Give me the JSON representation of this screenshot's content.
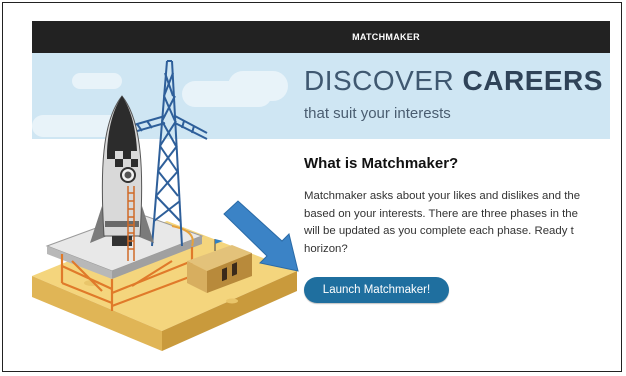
{
  "header": {
    "title": "MATCHMAKER"
  },
  "hero": {
    "title_light": "DISCOVER ",
    "title_bold": "CAREERS",
    "subtitle": "that suit your interests"
  },
  "section": {
    "heading": "What is Matchmaker?",
    "description_lines": [
      "Matchmaker asks about your likes and dislikes and the",
      "based on your interests. There are three phases in the",
      "will be updated as you complete each phase. Ready t",
      "horizon?"
    ]
  },
  "cta": {
    "label": "Launch Matchmaker!"
  },
  "icons": {
    "illustration": "rocket-launchpad-illustration",
    "arrow": "pointer-arrow-icon"
  },
  "colors": {
    "topbar": "#222222",
    "sky": "#cfe6f3",
    "button": "#1f6f9f",
    "arrow": "#3b83c6",
    "tower": "#2e5f9a"
  }
}
